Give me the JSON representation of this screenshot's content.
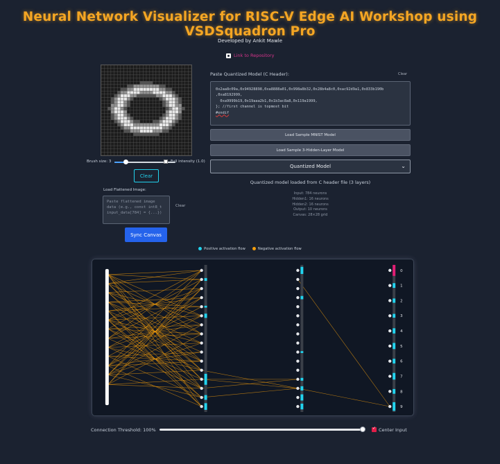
{
  "header": {
    "title": "Neural Network Visualizer for RISC-V Edge AI Workshop using VSDSquadron Pro",
    "developed_by": "Developed by Ankit Mawle",
    "repo_link": "Link to Repository"
  },
  "left_panel": {
    "brush_label": "Brush size: 3",
    "brush_size": 3,
    "full_intensity_label": "Full intensity (1.0)",
    "full_intensity_checked": false,
    "clear_label": "Clear",
    "load_flattened_label": "Load Flattened Image:",
    "flattened_placeholder": "Paste flattened image data (e.g., const int8_t input_data[784] = {...})",
    "flattened_clear": "Clear",
    "sync_label": "Sync Canvas"
  },
  "right_panel": {
    "paste_label": "Paste Quantized Model (C Header):",
    "clear_label": "Clear",
    "code_lines": [
      "0x2aa8c09a,0x94928898,0xa8888a01,0x998a8b32,0x28b4a8c0,0xac92d9a1,0x833b190b",
      ",0xa8192999,",
      "  0xa9999b19,0x19aaa2b1,0x1b3ac8a8,0x119a1999,",
      "}; //first channel is topmost bit",
      "",
      "#endif"
    ],
    "load_mnist_label": "Load Sample MNIST Model",
    "load_3h_label": "Load Sample 3-Hidden-Layer Model",
    "model_select_value": "Quantized Model",
    "status_text": "Quantized model loaded from C header file (3 layers)",
    "stats": [
      "Input: 784 neurons",
      "Hidden1: 16 neurons",
      "Hidden2: 16 neurons",
      "Output: 10 neurons",
      "Canvas: 28×28 grid"
    ]
  },
  "legend": {
    "positive": "Positive activation flow",
    "negative": "Negative activation flow",
    "positive_color": "#22d3ee",
    "negative_color": "#f59e0b"
  },
  "network": {
    "output_labels": [
      "0",
      "1",
      "2",
      "3",
      "4",
      "5",
      "6",
      "7",
      "8",
      "9"
    ],
    "hidden1_activations": [
      0.0,
      0.15,
      0.0,
      0.0,
      0.05,
      0.3,
      0.0,
      0.0,
      0.0,
      0.0,
      0.0,
      0.0,
      1.0,
      0.0,
      0.35,
      0.55
    ],
    "hidden2_activations": [
      0.6,
      0.0,
      0.0,
      0.2,
      0.0,
      0.0,
      0.0,
      0.0,
      0.0,
      0.05,
      0.0,
      0.0,
      0.15,
      0.3,
      0.5,
      0.45
    ],
    "output_activations": [
      1.0,
      0.35,
      0.3,
      0.25,
      0.4,
      0.5,
      0.35,
      0.55,
      0.35,
      0.75
    ],
    "output_highlight_color": "#e11d74",
    "bar_color": "#22d3ee"
  },
  "controls": {
    "threshold_label": "Connection Threshold: 100%",
    "threshold_value": 100,
    "center_input_label": "Center Input",
    "center_input_checked": true
  },
  "icons": {
    "repo": "github-icon",
    "select": "chevron-down-icon"
  }
}
